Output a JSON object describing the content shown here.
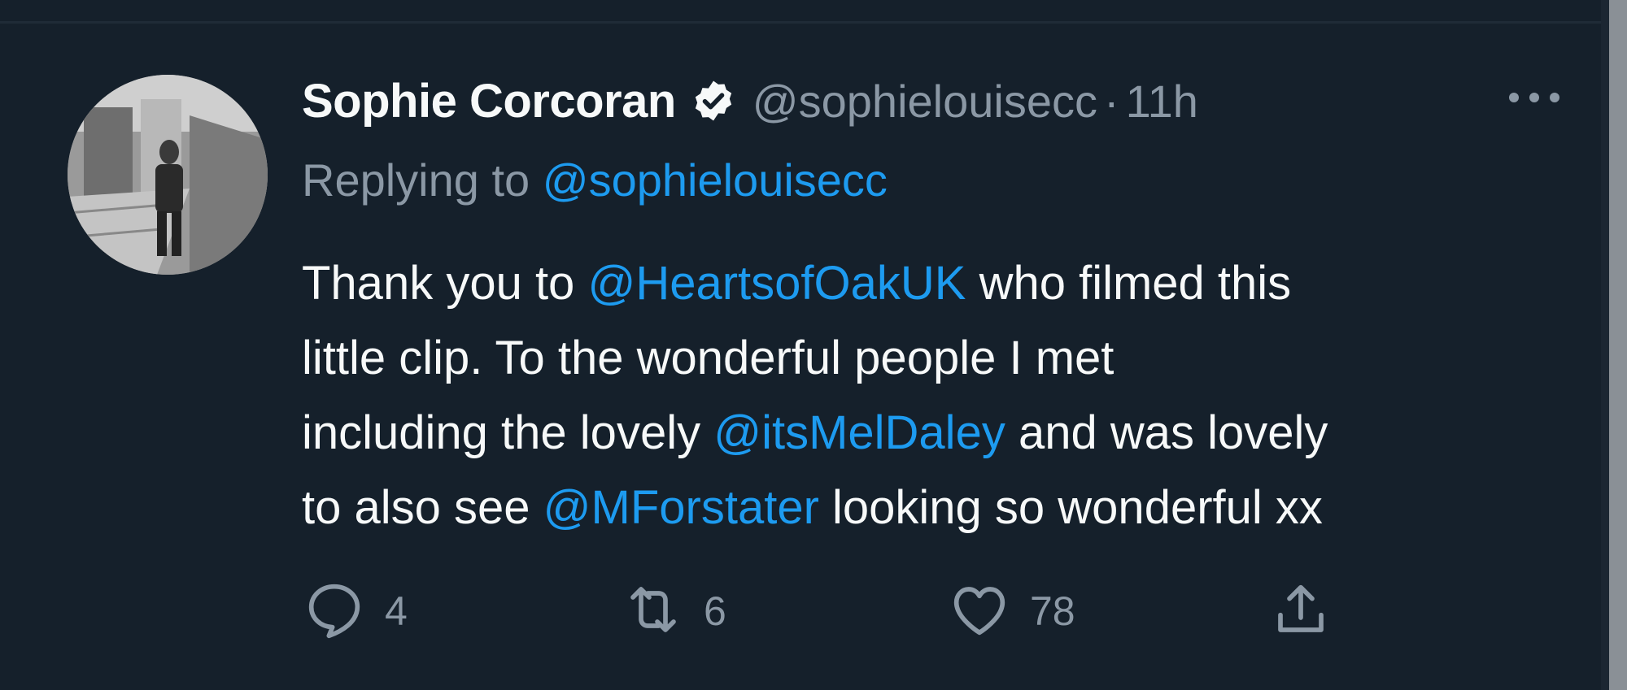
{
  "tweet": {
    "author_name": "Sophie Corcoran",
    "verified_icon": "verified-badge-icon",
    "handle": "@sophielouisecc",
    "separator": "·",
    "time": "11h",
    "more_icon": "more-options-icon",
    "replying_prefix": "Replying to",
    "replying_handle": "@sophielouisecc",
    "body": {
      "line1": {
        "t1": "Thank you to ",
        "m1": "@HeartsofOakUK",
        "t2": " who filmed this"
      },
      "line2": {
        "t1": "little clip. To the wonderful people I met"
      },
      "line3": {
        "t1": "including the lovely ",
        "m1": "@itsMelDaley",
        "t2": " and was lovely"
      },
      "line4": {
        "t1": "to also see ",
        "m1": "@MForstater",
        "t2": " looking so wonderful xx"
      }
    },
    "actions": {
      "reply": {
        "icon": "reply-icon",
        "count": "4"
      },
      "retweet": {
        "icon": "retweet-icon",
        "count": "6"
      },
      "like": {
        "icon": "heart-icon",
        "count": "78"
      },
      "share": {
        "icon": "share-icon"
      }
    }
  },
  "colors": {
    "background": "#15202b",
    "text": "#f7f9f9",
    "secondary": "#8b98a5",
    "link": "#1d9bf0"
  }
}
